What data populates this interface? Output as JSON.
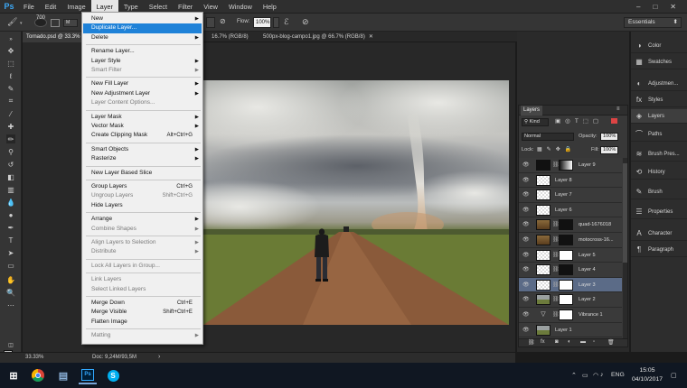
{
  "menubar": {
    "logo": "Ps",
    "items": [
      "File",
      "Edit",
      "Image",
      "Layer",
      "Type",
      "Select",
      "Filter",
      "View",
      "Window",
      "Help"
    ],
    "active": "Layer",
    "window_controls": [
      "–",
      "□",
      "✕"
    ]
  },
  "options_bar": {
    "brush_size": "700",
    "flow_label": "Flow:",
    "flow_value": "100%",
    "workspace": "Essentials"
  },
  "doc_tabs": [
    {
      "label": "Tornado.psd @ 33.3%"
    },
    {
      "label": "16.7% (RGB/8)"
    },
    {
      "label": "500px-blog-campo1.jpg @ 66.7% (RGB/8)"
    }
  ],
  "status": {
    "zoom": "33.33%",
    "doc": "Doc: 9,24M/93,5M"
  },
  "layer_menu": {
    "items": [
      {
        "label": "New",
        "submenu": true
      },
      {
        "label": "Duplicate Layer...",
        "highlight": true
      },
      {
        "label": "Delete",
        "submenu": true
      },
      {
        "sep": true
      },
      {
        "label": "Rename Layer..."
      },
      {
        "label": "Layer Style",
        "submenu": true
      },
      {
        "label": "Smart Filter",
        "submenu": true,
        "disabled": true
      },
      {
        "sep": true
      },
      {
        "label": "New Fill Layer",
        "submenu": true
      },
      {
        "label": "New Adjustment Layer",
        "submenu": true
      },
      {
        "label": "Layer Content Options...",
        "disabled": true
      },
      {
        "sep": true
      },
      {
        "label": "Layer Mask",
        "submenu": true
      },
      {
        "label": "Vector Mask",
        "submenu": true
      },
      {
        "label": "Create Clipping Mask",
        "shortcut": "Alt+Ctrl+G"
      },
      {
        "sep": true
      },
      {
        "label": "Smart Objects",
        "submenu": true
      },
      {
        "label": "Rasterize",
        "submenu": true
      },
      {
        "sep": true
      },
      {
        "label": "New Layer Based Slice"
      },
      {
        "sep": true
      },
      {
        "label": "Group Layers",
        "shortcut": "Ctrl+G"
      },
      {
        "label": "Ungroup Layers",
        "shortcut": "Shift+Ctrl+G",
        "disabled": true
      },
      {
        "label": "Hide Layers"
      },
      {
        "sep": true
      },
      {
        "label": "Arrange",
        "submenu": true
      },
      {
        "label": "Combine Shapes",
        "submenu": true,
        "disabled": true
      },
      {
        "sep": true
      },
      {
        "label": "Align Layers to Selection",
        "submenu": true,
        "disabled": true
      },
      {
        "label": "Distribute",
        "submenu": true,
        "disabled": true
      },
      {
        "sep": true
      },
      {
        "label": "Lock All Layers in Group...",
        "disabled": true
      },
      {
        "sep": true
      },
      {
        "label": "Link Layers",
        "disabled": true
      },
      {
        "label": "Select Linked Layers",
        "disabled": true
      },
      {
        "sep": true
      },
      {
        "label": "Merge Down",
        "shortcut": "Ctrl+E"
      },
      {
        "label": "Merge Visible",
        "shortcut": "Shift+Ctrl+E"
      },
      {
        "label": "Flatten Image"
      },
      {
        "sep": true
      },
      {
        "label": "Matting",
        "submenu": true,
        "disabled": true
      }
    ]
  },
  "layers_panel": {
    "title": "Layers",
    "filter_kind": "Kind",
    "blend_mode": "Normal",
    "opacity_label": "Opacity:",
    "opacity": "100%",
    "lock_label": "Lock:",
    "fill_label": "Fill:",
    "fill": "100%",
    "layers": [
      {
        "name": "Layer 9",
        "thumb": "dark",
        "mask": "grad"
      },
      {
        "name": "Layer 8",
        "thumb": "trans"
      },
      {
        "name": "Layer 7",
        "thumb": "trans"
      },
      {
        "name": "Layer 6",
        "thumb": "trans"
      },
      {
        "name": "quad-1676018",
        "thumb": "warm",
        "mask": "black"
      },
      {
        "name": "motocross-16...",
        "thumb": "warm",
        "mask": "black"
      },
      {
        "name": "Layer 5",
        "thumb": "trans",
        "mask": "white"
      },
      {
        "name": "Layer 4",
        "thumb": "trans",
        "mask": "black"
      },
      {
        "name": "Layer 3",
        "thumb": "trans",
        "mask": "white",
        "selected": true
      },
      {
        "name": "Layer 2",
        "thumb": "land",
        "mask": "white"
      },
      {
        "name": "Vibrance 1",
        "thumb": "adj",
        "mask": "white"
      },
      {
        "name": "Layer 1",
        "thumb": "land"
      }
    ]
  },
  "right_panels": [
    {
      "label": "Color",
      "icon": "color-icon"
    },
    {
      "label": "Swatches",
      "icon": "swatches-icon"
    },
    {
      "label": "Adjustmen...",
      "icon": "adjustments-icon"
    },
    {
      "label": "Styles",
      "icon": "styles-icon"
    },
    {
      "label": "Layers",
      "icon": "layers-icon",
      "active": true
    },
    {
      "label": "Paths",
      "icon": "paths-icon"
    },
    {
      "label": "Brush Pres...",
      "icon": "brush-presets-icon"
    },
    {
      "label": "History",
      "icon": "history-icon"
    },
    {
      "label": "Brush",
      "icon": "brush-icon"
    },
    {
      "label": "Properties",
      "icon": "properties-icon"
    },
    {
      "label": "Character",
      "icon": "character-icon"
    },
    {
      "label": "Paragraph",
      "icon": "paragraph-icon"
    }
  ],
  "taskbar": {
    "lang": "ENG",
    "time": "15:05",
    "date": "04/10/2017"
  },
  "colors": {
    "highlight": "#1f82d8",
    "selected_layer": "#5b6b87",
    "ps_blue": "#3da8f5"
  }
}
